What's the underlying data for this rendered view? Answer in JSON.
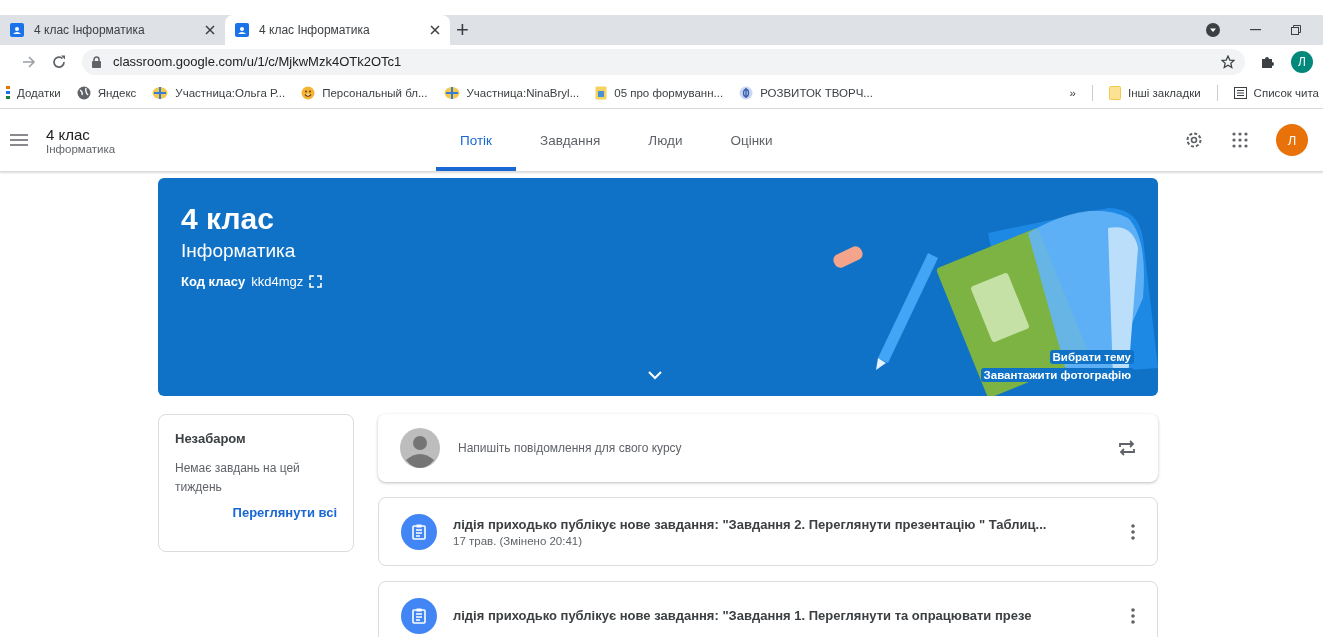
{
  "browser": {
    "tabs": [
      {
        "title": "4 клас Інформатика",
        "selected": false
      },
      {
        "title": "4 клас Інформатика",
        "selected": true
      }
    ],
    "new_tab": "+",
    "url": "classroom.google.com/u/1/c/MjkwMzk4OTk2OTc1",
    "profile_initial": "Л",
    "bookmarks": [
      {
        "label": "Додатки",
        "kind": "apps"
      },
      {
        "label": "Яндекс",
        "kind": "globe"
      },
      {
        "label": "Участница:Ольга Р...",
        "kind": "wiki"
      },
      {
        "label": "Персональный бл...",
        "kind": "emoji"
      },
      {
        "label": "Участница:NinaBryl...",
        "kind": "wiki"
      },
      {
        "label": "05 про формуванн...",
        "kind": "doc"
      },
      {
        "label": "РОЗВИТОК ТВОРЧ...",
        "kind": "site"
      }
    ],
    "overflow": "»",
    "other_bookmarks": "Інші закладки",
    "reading_list": "Список чита"
  },
  "header": {
    "course": "4 клас",
    "subject": "Інформатика",
    "tabs": [
      {
        "label": "Потік",
        "selected": true
      },
      {
        "label": "Завдання",
        "selected": false
      },
      {
        "label": "Люди",
        "selected": false
      },
      {
        "label": "Оцінки",
        "selected": false
      }
    ],
    "avatar_initial": "Л"
  },
  "banner": {
    "title": "4 клас",
    "subtitle": "Інформатика",
    "code_label": "Код класу",
    "code": "kkd4mgz",
    "links": [
      "Вибрати тему",
      "Завантажити фотографію"
    ]
  },
  "upcoming": {
    "title": "Незабаром",
    "message": "Немає завдань на цей тиждень",
    "link": "Переглянути всі"
  },
  "composer": {
    "placeholder": "Напишіть повідомлення для свого курсу"
  },
  "posts": [
    {
      "title": "лідія приходько публікує нове завдання: \"Завдання 2. Переглянути презентацію \" Таблиц...",
      "meta": "17 трав. (Змінено 20:41)"
    },
    {
      "title": "лідія приходько публікує нове завдання: \"Завдання 1. Переглянути та опрацювати презе"
    }
  ]
}
